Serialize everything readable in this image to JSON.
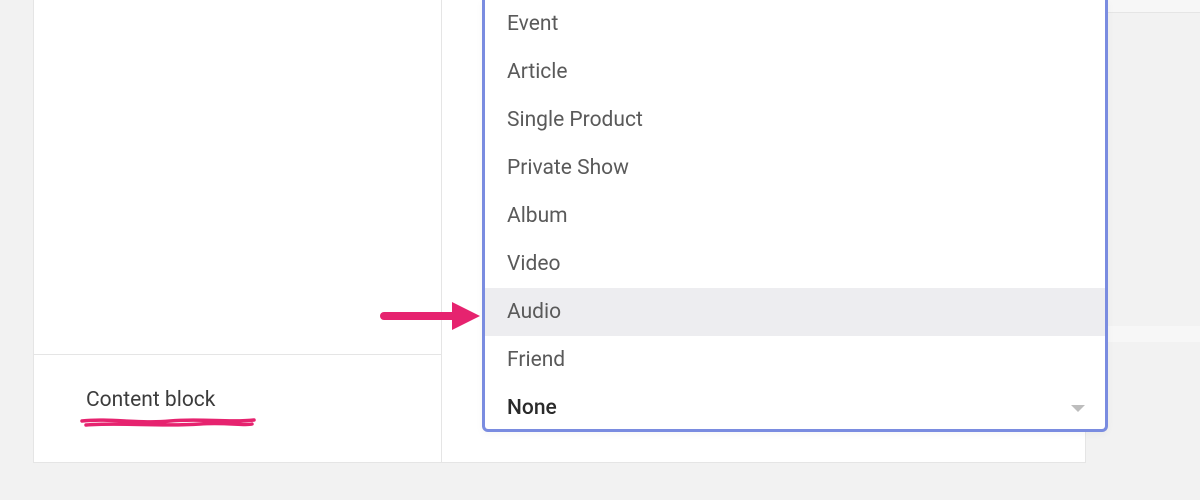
{
  "form": {
    "content_block_label": "Content block"
  },
  "dropdown": {
    "options": [
      {
        "label": "Event",
        "highlighted": false
      },
      {
        "label": "Article",
        "highlighted": false
      },
      {
        "label": "Single Product",
        "highlighted": false
      },
      {
        "label": "Private Show",
        "highlighted": false
      },
      {
        "label": "Album",
        "highlighted": false
      },
      {
        "label": "Video",
        "highlighted": false
      },
      {
        "label": "Audio",
        "highlighted": true
      },
      {
        "label": "Friend",
        "highlighted": false
      }
    ],
    "selected": "None"
  },
  "annotation": {
    "arrow_color": "#e6236f",
    "underline_color": "#e6236f"
  }
}
